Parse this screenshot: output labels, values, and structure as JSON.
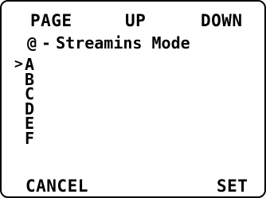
{
  "softkeys": {
    "page": "PAGE",
    "up": "UP",
    "down": "DOWN",
    "cancel": "CANCEL",
    "set": "SET"
  },
  "screen": {
    "index": "@",
    "separator": "-",
    "title": "Streamins Mode"
  },
  "options": [
    {
      "label": "A",
      "cursor": ">"
    },
    {
      "label": "B",
      "cursor": ""
    },
    {
      "label": "C",
      "cursor": ""
    },
    {
      "label": "D",
      "cursor": ""
    },
    {
      "label": "E",
      "cursor": ""
    },
    {
      "label": "F",
      "cursor": ""
    }
  ],
  "selected_option": "A"
}
